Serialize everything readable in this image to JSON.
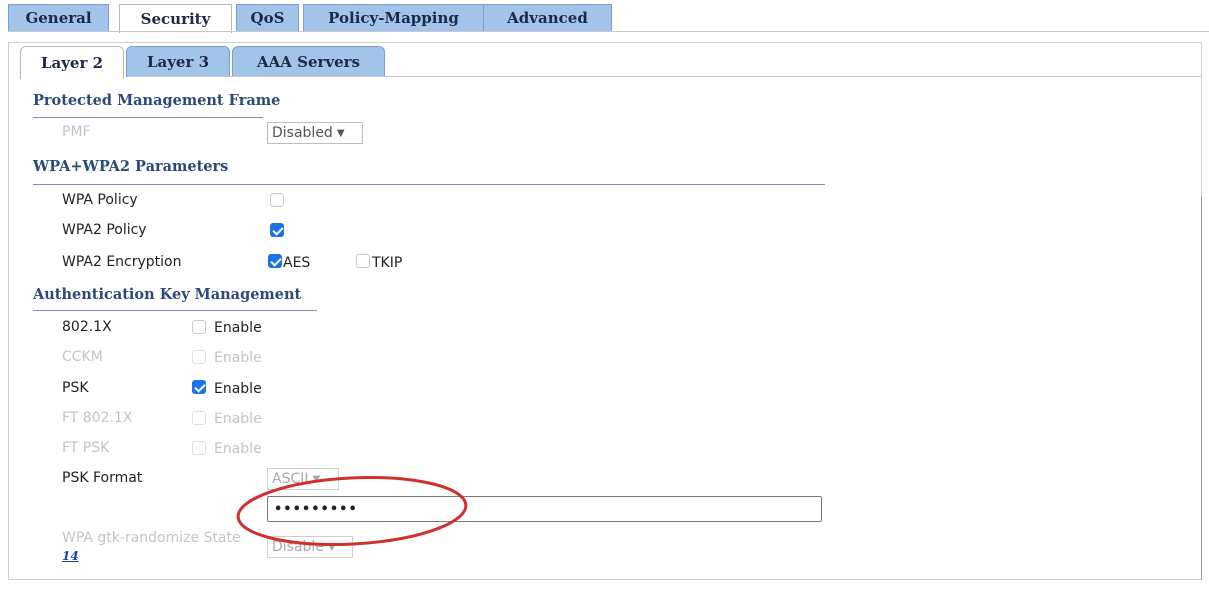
{
  "top_tabs": [
    {
      "label": "General",
      "active": false
    },
    {
      "label": "Security",
      "active": true
    },
    {
      "label": "QoS",
      "active": false
    },
    {
      "label": "Policy-Mapping",
      "active": false
    },
    {
      "label": "Advanced",
      "active": false
    }
  ],
  "sub_tabs": [
    {
      "label": "Layer 2",
      "active": true
    },
    {
      "label": "Layer 3",
      "active": false
    },
    {
      "label": "AAA Servers",
      "active": false
    }
  ],
  "pmf_section": {
    "title": "Protected Management Frame",
    "pmf_label": "PMF",
    "pmf_value": "Disabled"
  },
  "wpa_section": {
    "title": "WPA+WPA2 Parameters",
    "wpa_policy_label": "WPA Policy",
    "wpa_policy_checked": false,
    "wpa2_policy_label": "WPA2 Policy",
    "wpa2_policy_checked": true,
    "wpa2_encryption_label": "WPA2 Encryption",
    "aes_label": "AES",
    "aes_checked": true,
    "tkip_label": "TKIP",
    "tkip_checked": false
  },
  "akm_section": {
    "title": "Authentication Key Management",
    "rows": [
      {
        "label": "802.1X",
        "enable_label": "Enable",
        "checked": false,
        "disabled": false
      },
      {
        "label": "CCKM",
        "enable_label": "Enable",
        "checked": false,
        "disabled": true
      },
      {
        "label": "PSK",
        "enable_label": "Enable",
        "checked": true,
        "disabled": false
      },
      {
        "label": "FT 802.1X",
        "enable_label": "Enable",
        "checked": false,
        "disabled": true
      },
      {
        "label": "FT PSK",
        "enable_label": "Enable",
        "checked": false,
        "disabled": true
      }
    ],
    "psk_format_label": "PSK Format",
    "psk_format_value": "ASCII",
    "psk_value": "•••••••••",
    "gtk_label": "WPA gtk-randomize State",
    "gtk_value": "Disable",
    "gtk_link": "14"
  },
  "colors": {
    "tab_bg": "#a3c4ea",
    "section_header": "#2b4a7a",
    "checkbox_checked": "#1a73e8",
    "annotation_ellipse": "#d0312d"
  }
}
